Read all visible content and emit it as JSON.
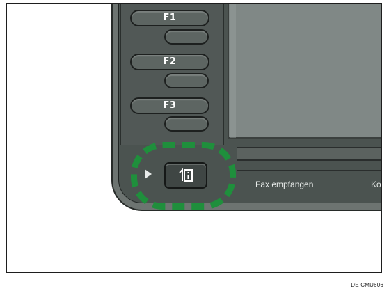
{
  "function_keys": [
    {
      "label": "F1"
    },
    {
      "label": "F2"
    },
    {
      "label": "F3"
    }
  ],
  "bottom_bar": {
    "fax_label": "Fax empfangen",
    "next_label": "Kom"
  },
  "highlight": {
    "target": "simple-screen-key",
    "color": "#1f8f3c"
  },
  "icons": {
    "indicator": "arrow-right-icon",
    "key": "info-icon"
  },
  "caption": "DE CMU606"
}
